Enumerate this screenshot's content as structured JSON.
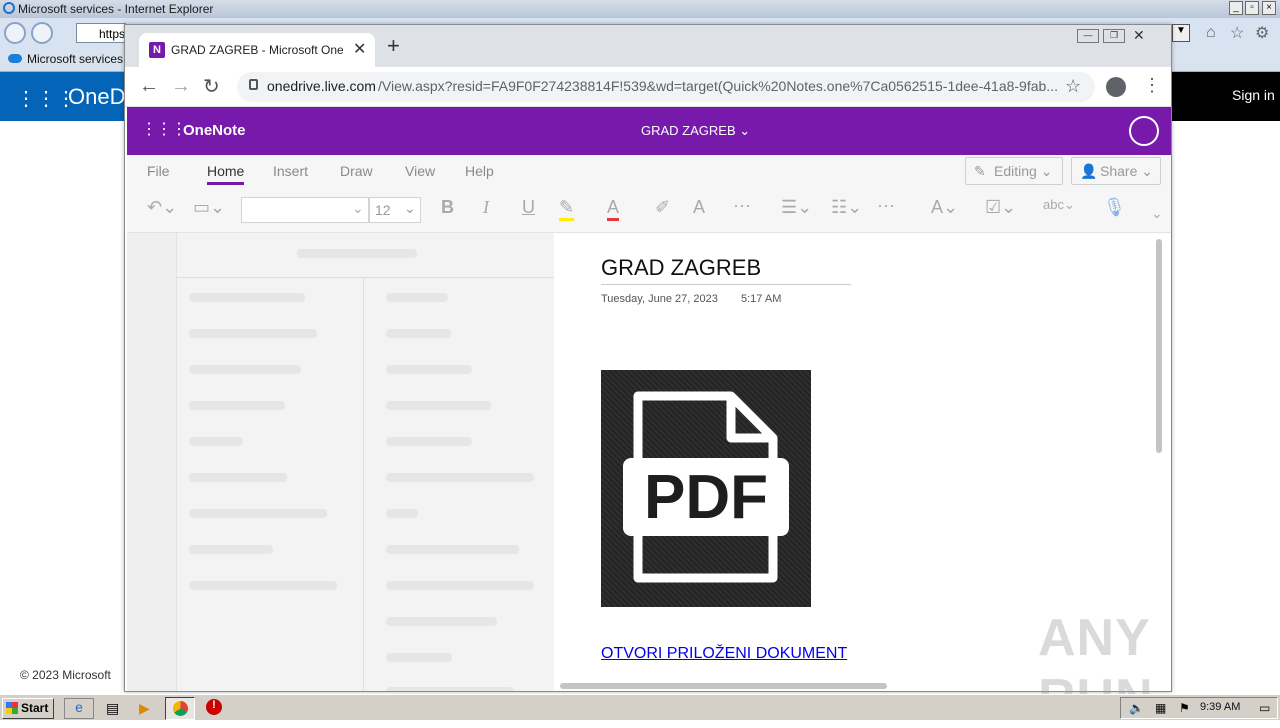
{
  "ie": {
    "title": "Microsoft services - Internet Explorer",
    "address_partial": "https",
    "tab_label": "Microsoft services",
    "onedrive_partial": "OneD",
    "sign_in": "Sign in",
    "footer": "© 2023 Microsoft"
  },
  "chrome": {
    "tab_title": "GRAD ZAGREB - Microsoft OneNote",
    "url_domain": "onedrive.live.com",
    "url_path": "/View.aspx?resid=FA9F0F274238814F!539&wd=target(Quick%20Notes.one%7Ca0562515-1dee-41a8-9fab..."
  },
  "onenote": {
    "app_name": "OneNote",
    "notebook_title": "GRAD ZAGREB",
    "ribbon_tabs": [
      "File",
      "Home",
      "Insert",
      "Draw",
      "View",
      "Help"
    ],
    "active_tab": "Home",
    "editing_label": "Editing",
    "share_label": "Share",
    "font_size": "12",
    "page": {
      "title": "GRAD ZAGREB",
      "date": "Tuesday, June 27, 2023",
      "time": "5:17 AM",
      "pdf_label": "PDF",
      "link_text": "OTVORI PRILOŽENI DOKUMENT"
    }
  },
  "taskbar": {
    "start_label": "Start",
    "clock": "9:39 AM"
  },
  "watermark": "ANY RUN",
  "colors": {
    "onenote_purple": "#7719aa",
    "onedrive_blue": "#0364b8",
    "link": "#0000ee"
  }
}
